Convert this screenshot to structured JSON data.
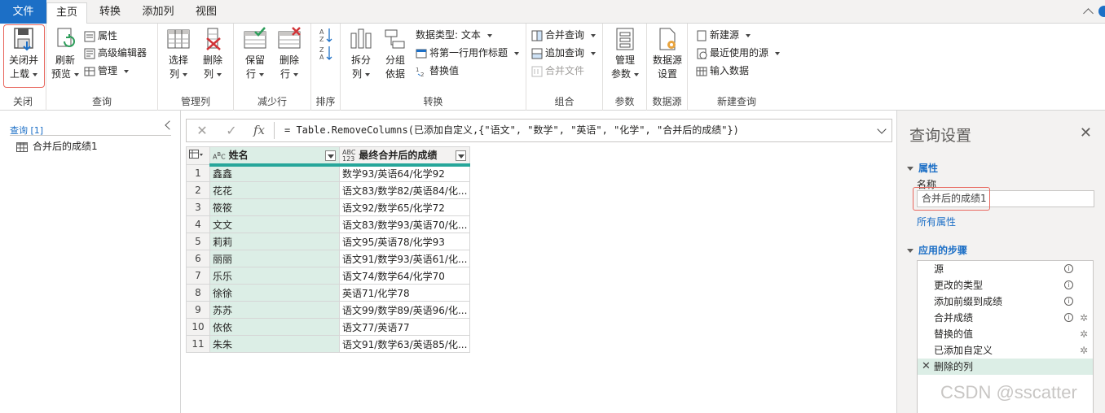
{
  "menu": {
    "file": "文件",
    "tabs": [
      "主页",
      "转换",
      "添加列",
      "视图"
    ]
  },
  "ribbon": {
    "close": {
      "btn": "关闭并\n上载",
      "line1": "关闭并",
      "line2": "上载",
      "group": "关闭"
    },
    "query": {
      "refresh1": "刷新",
      "refresh2": "预览",
      "properties": "属性",
      "advanced": "高级编辑器",
      "manage": "管理",
      "group": "查询"
    },
    "cols": {
      "select1": "选择",
      "select2": "列",
      "remove1": "删除",
      "remove2": "列",
      "group": "管理列"
    },
    "rows": {
      "keep1": "保留",
      "keep2": "行",
      "remove1": "删除",
      "remove2": "行",
      "group": "减少行"
    },
    "sort": {
      "group": "排序"
    },
    "transform": {
      "split1": "拆分",
      "split2": "列",
      "group1": "分组",
      "group2": "依据",
      "datatype": "数据类型: 文本",
      "firstrow": "将第一行用作标题",
      "replace": "替换值",
      "group": "转换"
    },
    "combine": {
      "merge": "合并查询",
      "append": "追加查询",
      "files": "合并文件",
      "group": "组合"
    },
    "params": {
      "manage1": "管理",
      "manage2": "参数",
      "group": "参数"
    },
    "datasource": {
      "btn1": "数据源",
      "btn2": "设置",
      "group": "数据源"
    },
    "newquery": {
      "new": "新建源",
      "recent": "最近使用的源",
      "enter": "输入数据",
      "group": "新建查询"
    }
  },
  "left": {
    "header": "查询 [1]",
    "items": [
      "合并后的成绩1"
    ]
  },
  "formula": {
    "text": "= Table.RemoveColumns(已添加自定义,{\"语文\", \"数学\", \"英语\", \"化学\", \"合并后的成绩\"})"
  },
  "table": {
    "columns": [
      {
        "name": "姓名",
        "type": "ABC"
      },
      {
        "name": "最终合并后的成绩",
        "type": "ABC123"
      }
    ],
    "rows": [
      [
        "1",
        "鑫鑫",
        "数学93/英语64/化学92"
      ],
      [
        "2",
        "花花",
        "语文83/数学82/英语84/化..."
      ],
      [
        "3",
        "筱筱",
        "语文92/数学65/化学72"
      ],
      [
        "4",
        "文文",
        "语文83/数学93/英语70/化..."
      ],
      [
        "5",
        "莉莉",
        "语文95/英语78/化学93"
      ],
      [
        "6",
        "丽丽",
        "语文91/数学93/英语61/化..."
      ],
      [
        "7",
        "乐乐",
        "语文74/数学64/化学70"
      ],
      [
        "8",
        "徐徐",
        "英语71/化学78"
      ],
      [
        "9",
        "苏苏",
        "语文99/数学89/英语96/化..."
      ],
      [
        "10",
        "依依",
        "语文77/英语77"
      ],
      [
        "11",
        "朱朱",
        "语文91/数学63/英语85/化..."
      ]
    ]
  },
  "settings": {
    "title": "查询设置",
    "props_header": "属性",
    "name_label": "名称",
    "name_value": "合并后的成绩1",
    "all_props": "所有属性",
    "steps_header": "应用的步骤",
    "steps": [
      "源",
      "更改的类型",
      "添加前缀到成绩",
      "合并成绩",
      "替换的值",
      "已添加自定义",
      "删除的列"
    ]
  },
  "watermark": "CSDN @sscatter",
  "colors": {
    "accent": "#1c6fc6",
    "selected_col": "#dceee6",
    "highlight_box": "#e8675e"
  }
}
